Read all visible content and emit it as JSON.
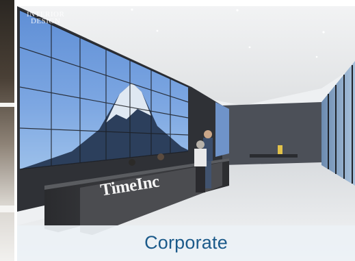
{
  "card": {
    "caption": "Corporate",
    "watermark": {
      "line1": "INTERIOR",
      "line2": "DESIGN"
    },
    "sign_text": "TimeInc"
  },
  "colors": {
    "caption_text": "#1b5a8a",
    "caption_band": "#ecf1f5"
  }
}
